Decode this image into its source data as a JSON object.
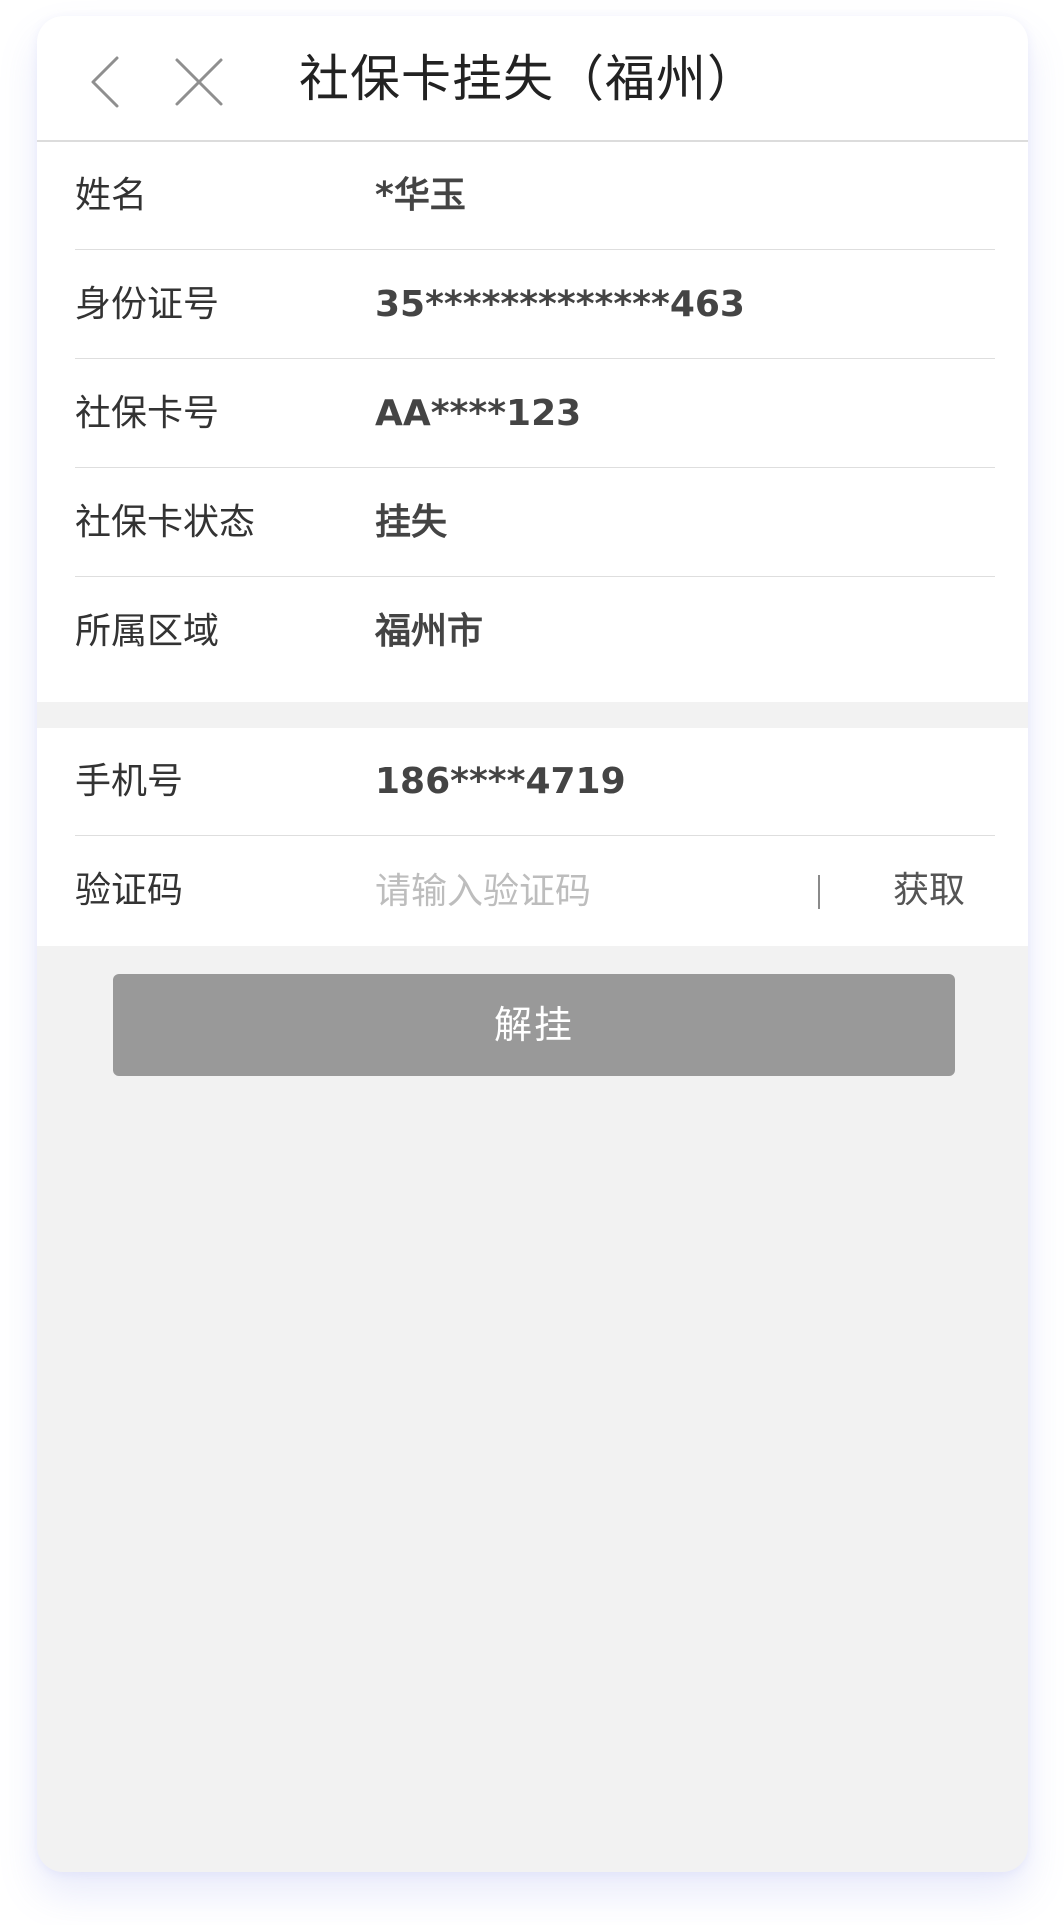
{
  "nav": {
    "title": "社保卡挂失（福州）",
    "back_icon": "chevron-left-icon",
    "close_icon": "close-icon"
  },
  "info": {
    "rows": [
      {
        "label": "姓名",
        "value": "*华玉"
      },
      {
        "label": "身份证号",
        "value": "35*************463"
      },
      {
        "label": "社保卡号",
        "value": "AA****123"
      },
      {
        "label": "社保卡状态",
        "value": "挂失"
      },
      {
        "label": "所属区域",
        "value": "福州市"
      }
    ]
  },
  "verify": {
    "phone_label": "手机号",
    "phone_value": "186****4719",
    "code_label": "验证码",
    "code_value": "",
    "code_placeholder": "请输入验证码",
    "get_code_label": "获取"
  },
  "actions": {
    "unlock_label": "解挂"
  },
  "colors": {
    "page_bg": "#f2f2f2",
    "card_bg": "#ffffff",
    "button_disabled": "#999999",
    "placeholder": "#bdbdbd"
  }
}
